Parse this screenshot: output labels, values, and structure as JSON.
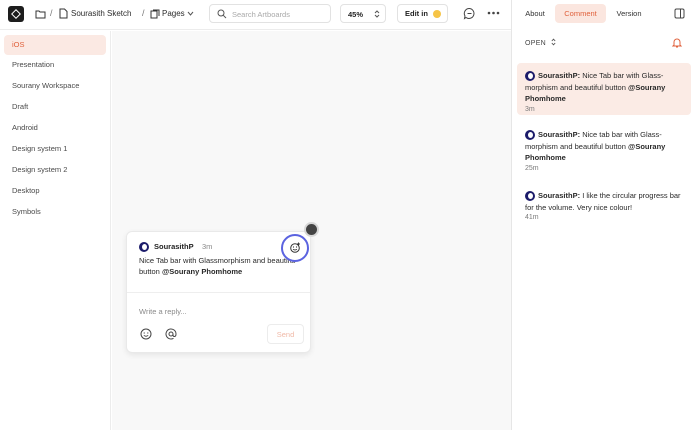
{
  "toolbar": {
    "folder_name": "Sourasith Sketch",
    "pages_label": "Pages",
    "separator": "/",
    "search_placeholder": "Search Artboards",
    "zoom": "45%",
    "edit_label": "Edit in"
  },
  "sidebar": {
    "items": [
      {
        "label": "iOS",
        "active": true
      },
      {
        "label": "Presentation"
      },
      {
        "label": "Sourany Workspace"
      },
      {
        "label": "Draft"
      },
      {
        "label": "Android"
      },
      {
        "label": "Design system 1"
      },
      {
        "label": "Design system 2"
      },
      {
        "label": "Desktop"
      },
      {
        "label": "Symbols"
      }
    ]
  },
  "canvas_comment": {
    "author": "SourasithP",
    "time": "3m",
    "body": "Nice Tab bar with Glassmorphism and beautiful button",
    "mention": "@Sourany Phomhome",
    "reply_placeholder": "Write a reply...",
    "send_label": "Send"
  },
  "right_panel": {
    "tabs": [
      {
        "label": "About"
      },
      {
        "label": "Comment",
        "active": true
      },
      {
        "label": "Version"
      }
    ],
    "filter_label": "OPEN",
    "comments": [
      {
        "author": "SourasithP:",
        "text": "Nice Tab bar with Glass-morphism and beautiful button",
        "mention": "@Sourany Phomhome",
        "time": "3m",
        "active": true
      },
      {
        "author": "SourasithP:",
        "text": "Nice tab bar with Glass-morphism and beautiful button",
        "mention": "@Sourany Phomhome",
        "time": "25m"
      },
      {
        "author": "SourasithP:",
        "text": "I like the circular progress bar for the volume. Very nice colour!",
        "mention": "",
        "time": "41m"
      }
    ]
  },
  "colors": {
    "accent": "#e0613c",
    "accent_bg": "#fbe9e3",
    "avatar": "#1b1b6a",
    "focus_ring": "#5b63e0"
  },
  "icons": [
    "app-logo-icon",
    "folder-icon",
    "document-icon",
    "pages-icon",
    "search-icon",
    "stepper-icon",
    "sketch-icon",
    "comment-icon",
    "more-icon",
    "panel-toggle-icon",
    "bell-icon",
    "chevron-updown-icon",
    "emoji-icon",
    "at-icon",
    "reaction-icon"
  ]
}
